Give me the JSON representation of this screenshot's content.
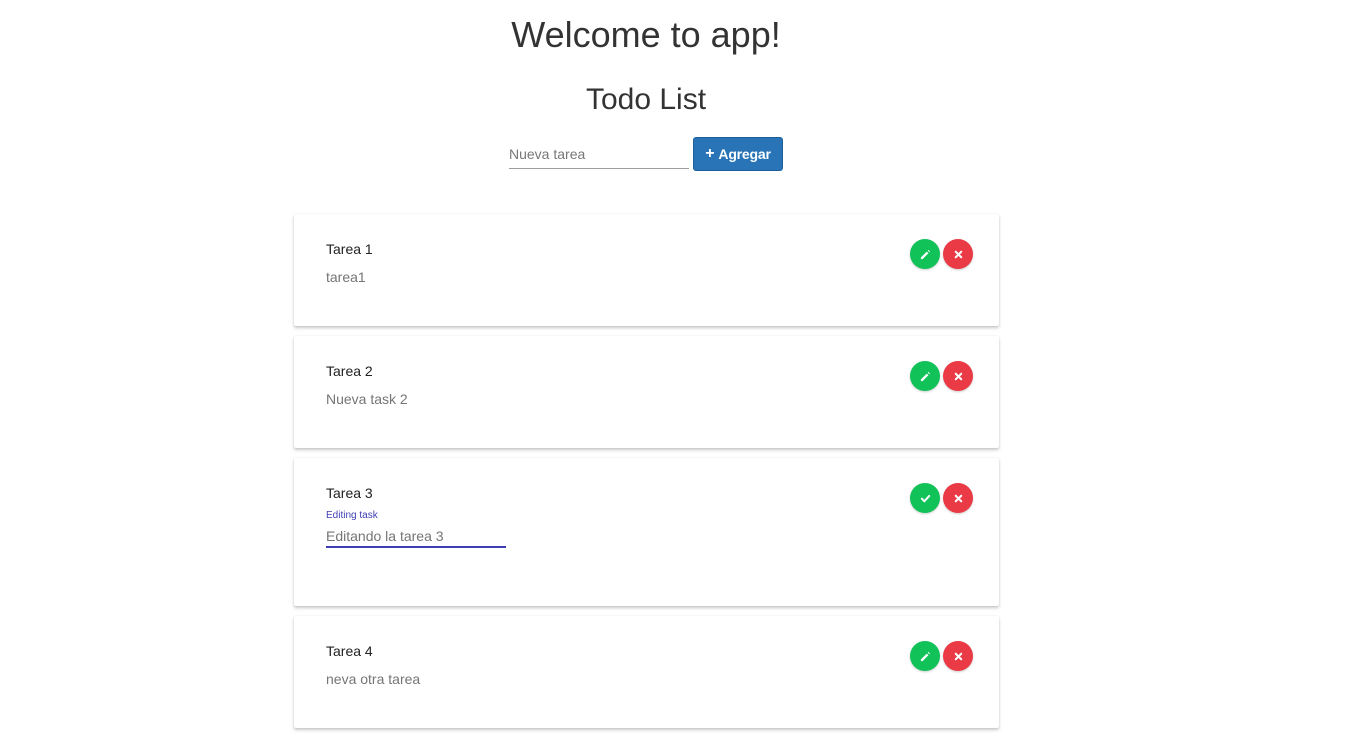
{
  "header": {
    "title": "Welcome to app!",
    "subtitle": "Todo List"
  },
  "new_task": {
    "placeholder": "Nueva tarea",
    "value": "",
    "add_label": "Agregar",
    "add_icon": "plus-icon"
  },
  "colors": {
    "primary": "#2874b7",
    "success": "#11c258",
    "danger": "#ea3a45",
    "editing_accent": "#3f3fb5"
  },
  "tasks": [
    {
      "title": "Tarea 1",
      "description": "tarea1",
      "editing": false,
      "primary_icon": "pencil-icon",
      "secondary_icon": "close-icon"
    },
    {
      "title": "Tarea 2",
      "description": "Nueva task 2",
      "editing": false,
      "primary_icon": "pencil-icon",
      "secondary_icon": "close-icon"
    },
    {
      "title": "Tarea 3",
      "editing": true,
      "edit_label": "Editing task",
      "edit_value": "Editando la tarea 3",
      "primary_icon": "check-icon",
      "secondary_icon": "close-icon"
    },
    {
      "title": "Tarea 4",
      "description": "neva otra tarea",
      "editing": false,
      "primary_icon": "pencil-icon",
      "secondary_icon": "close-icon"
    }
  ]
}
